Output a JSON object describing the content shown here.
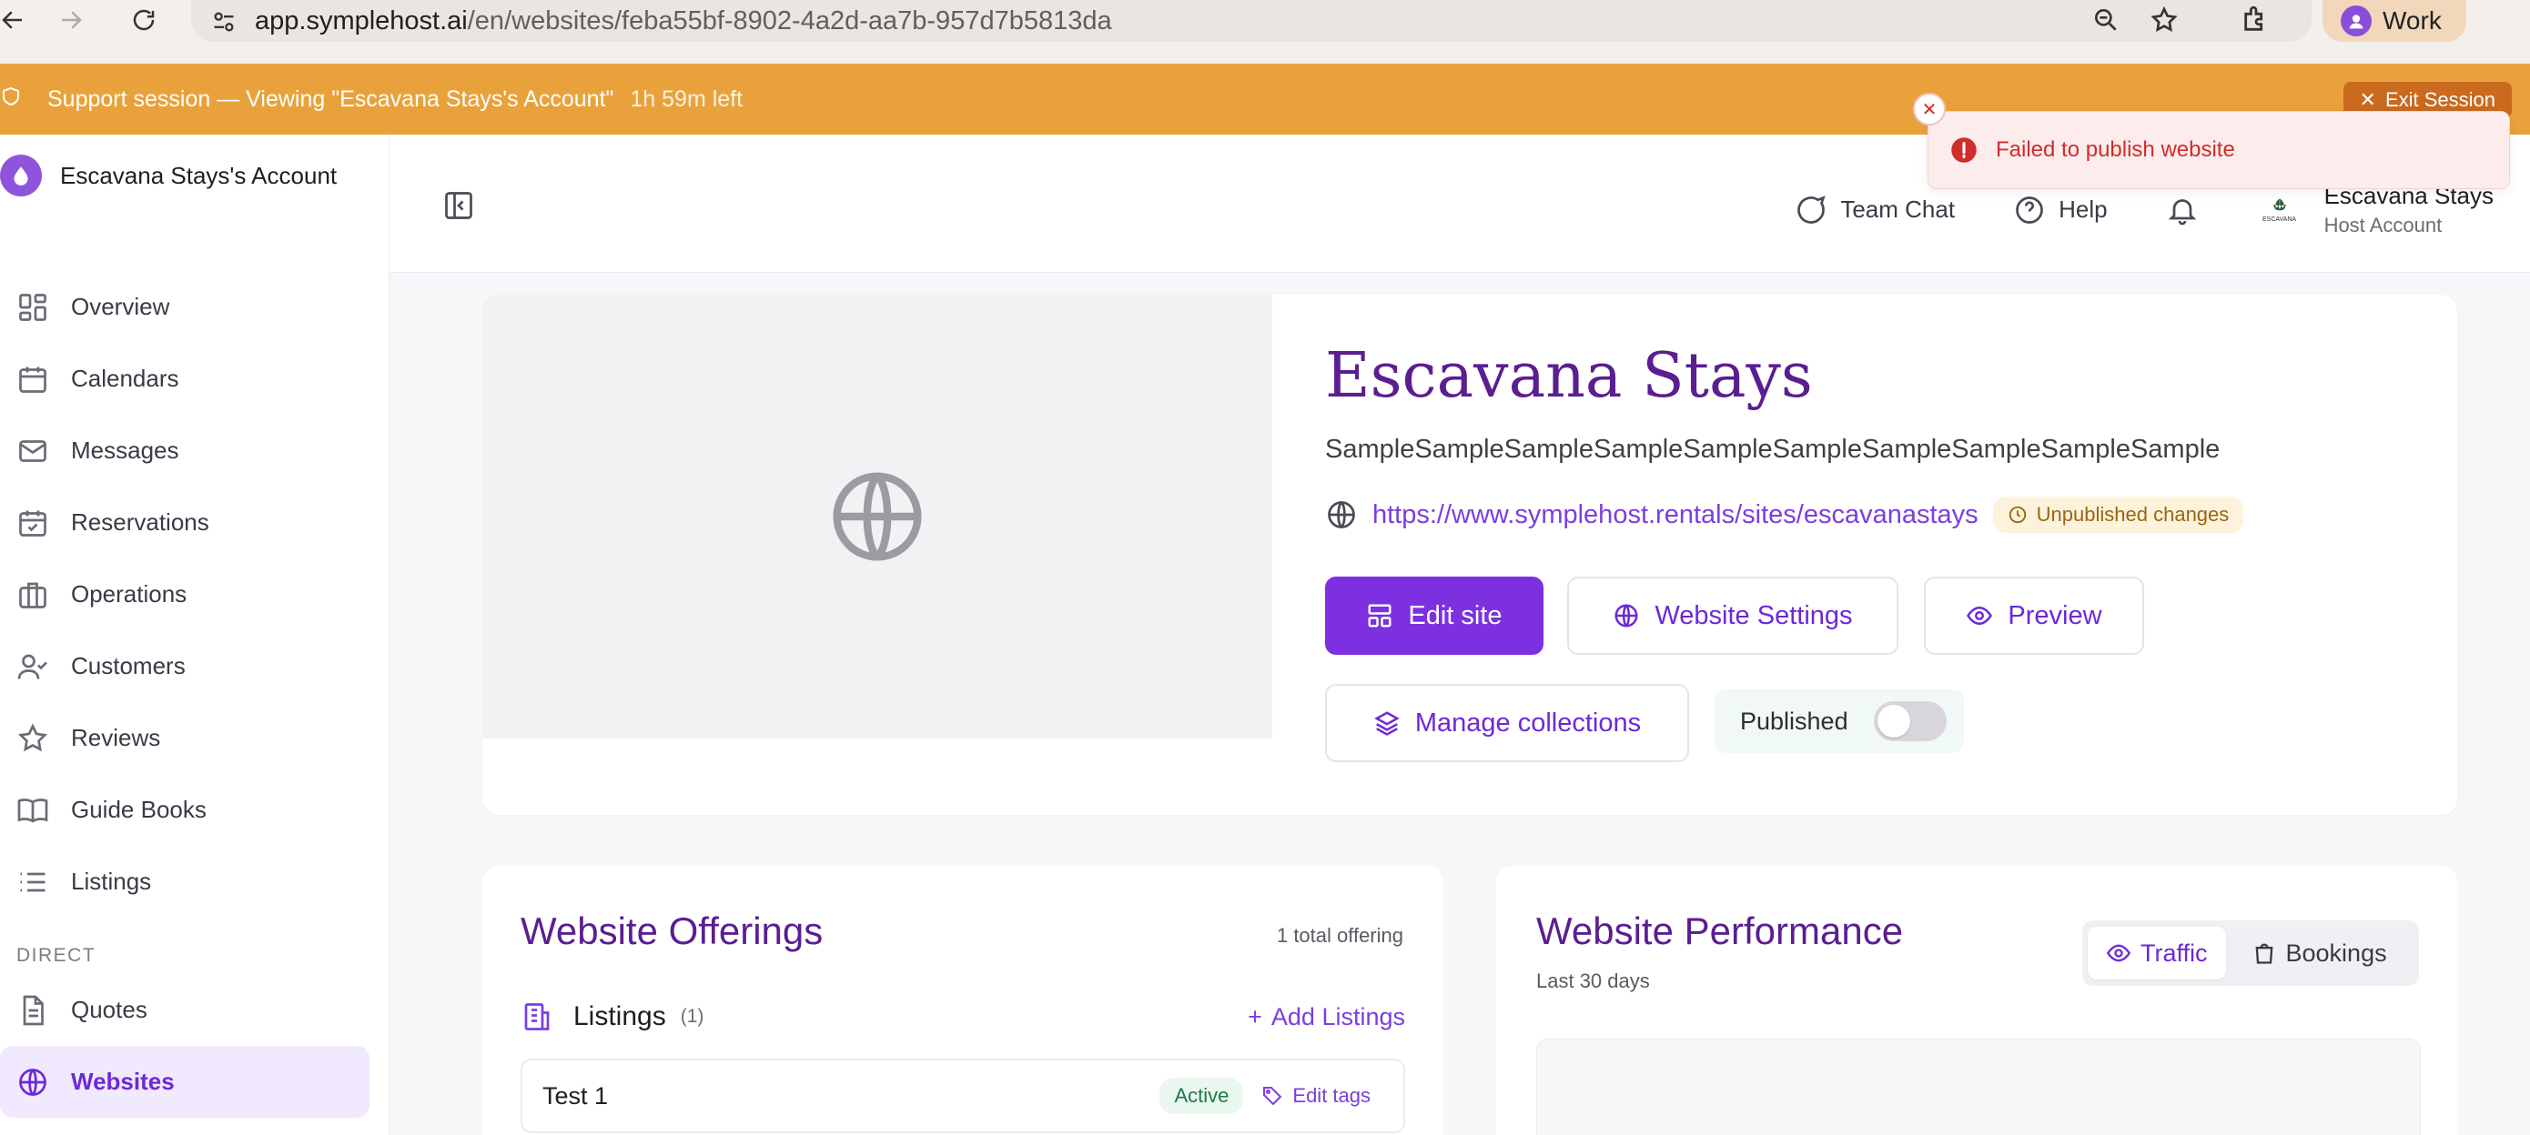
{
  "browser": {
    "url_host": "app.symplehost.ai",
    "url_path": "/en/websites/feba55bf-8902-4a2d-aa7b-957d7b5813da",
    "profile_label": "Work"
  },
  "support_banner": {
    "text": "Support session — Viewing \"Escavana Stays's Account\"",
    "time_left": "1h 59m left",
    "exit_label": "Exit Session"
  },
  "toast": {
    "message": "Failed to publish website"
  },
  "sidebar": {
    "account_name": "Escavana Stays's Account",
    "items": [
      {
        "label": "Overview",
        "icon": "grid-icon"
      },
      {
        "label": "Calendars",
        "icon": "calendar-icon"
      },
      {
        "label": "Messages",
        "icon": "mail-icon"
      },
      {
        "label": "Reservations",
        "icon": "calendar-check-icon"
      },
      {
        "label": "Operations",
        "icon": "briefcase-icon"
      },
      {
        "label": "Customers",
        "icon": "user-check-icon"
      },
      {
        "label": "Reviews",
        "icon": "star-icon"
      },
      {
        "label": "Guide Books",
        "icon": "book-icon"
      },
      {
        "label": "Listings",
        "icon": "list-icon"
      }
    ],
    "section_direct": "DIRECT",
    "direct_items": [
      {
        "label": "Quotes",
        "icon": "file-text-icon"
      },
      {
        "label": "Websites",
        "icon": "globe-icon",
        "active": true
      }
    ]
  },
  "topbar": {
    "team_chat": "Team Chat",
    "help": "Help",
    "user_name": "Escavana Stays",
    "user_role": "Host Account",
    "logo_text": "ESCAVANA"
  },
  "hero": {
    "title": "Escavana Stays",
    "description": "SampleSampleSampleSampleSampleSampleSampleSampleSampleSample",
    "link": "https://www.symplehost.rentals/sites/escavanastays",
    "badge": "Unpublished changes",
    "edit_site": "Edit site",
    "website_settings": "Website Settings",
    "preview": "Preview",
    "manage_collections": "Manage collections",
    "published_label": "Published",
    "published": false
  },
  "offerings": {
    "title": "Website Offerings",
    "total": "1 total offering",
    "listings_label": "Listings",
    "listings_count": "(1)",
    "add_listings": "Add Listings",
    "items": [
      {
        "name": "Test 1",
        "status": "Active",
        "edit_tags": "Edit tags"
      }
    ]
  },
  "performance": {
    "title": "Website Performance",
    "subtitle": "Last 30 days",
    "tab_traffic": "Traffic",
    "tab_bookings": "Bookings"
  },
  "colors": {
    "brand_purple": "#7c30e0",
    "title_purple": "#5b1e91",
    "banner_orange": "#e9a23b",
    "error_red": "#d12c2c"
  }
}
